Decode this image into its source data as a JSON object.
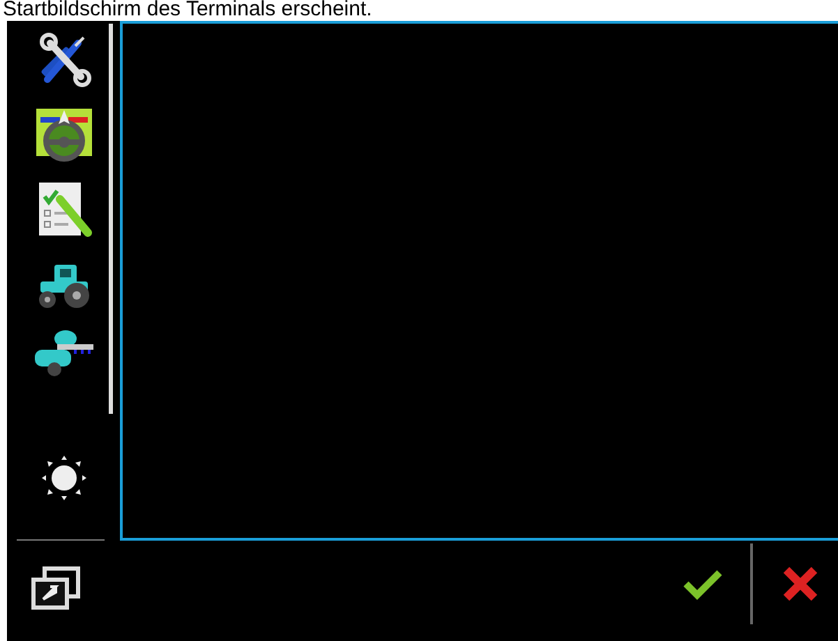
{
  "caption": "Startbildschirm des Terminals erscheint."
}
